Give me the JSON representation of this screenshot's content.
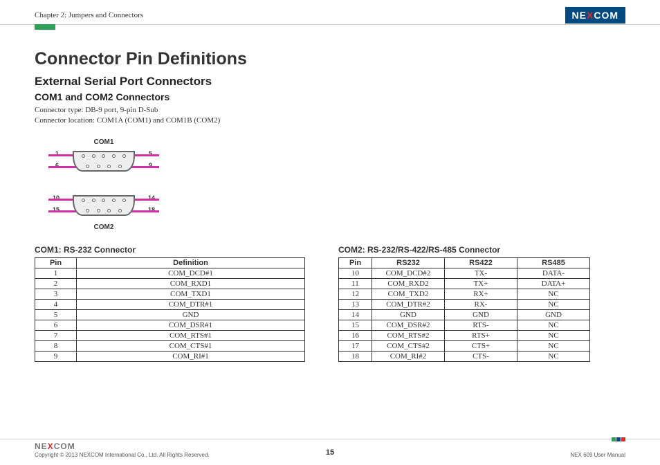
{
  "header": {
    "chapter": "Chapter 2: Jumpers and Connectors",
    "brand": "NE",
    "brand_x": "X",
    "brand2": "COM"
  },
  "titles": {
    "h1": "Connector Pin Definitions",
    "h2": "External Serial Port Connectors",
    "h3": "COM1 and COM2 Connectors",
    "line1": "Connector type: DB-9 port, 9-pin D-Sub",
    "line2": "Connector location: COM1A (COM1) and COM1B (COM2)"
  },
  "diagram": {
    "com1": {
      "label": "COM1",
      "p1": "1",
      "p5": "5",
      "p6": "6",
      "p9": "9"
    },
    "com2": {
      "label": "COM2",
      "p10": "10",
      "p14": "14",
      "p15": "15",
      "p18": "18"
    }
  },
  "table1": {
    "title": "COM1: RS-232 Connector",
    "head": [
      "Pin",
      "Definition"
    ],
    "rows": [
      [
        "1",
        "COM_DCD#1"
      ],
      [
        "2",
        "COM_RXD1"
      ],
      [
        "3",
        "COM_TXD1"
      ],
      [
        "4",
        "COM_DTR#1"
      ],
      [
        "5",
        "GND"
      ],
      [
        "6",
        "COM_DSR#1"
      ],
      [
        "7",
        "COM_RTS#1"
      ],
      [
        "8",
        "COM_CTS#1"
      ],
      [
        "9",
        "COM_RI#1"
      ]
    ]
  },
  "table2": {
    "title": "COM2: RS-232/RS-422/RS-485 Connector",
    "head": [
      "Pin",
      "RS232",
      "RS422",
      "RS485"
    ],
    "rows": [
      [
        "10",
        "COM_DCD#2",
        "TX-",
        "DATA-"
      ],
      [
        "11",
        "COM_RXD2",
        "TX+",
        "DATA+"
      ],
      [
        "12",
        "COM_TXD2",
        "RX+",
        "NC"
      ],
      [
        "13",
        "COM_DTR#2",
        "RX-",
        "NC"
      ],
      [
        "14",
        "GND",
        "GND",
        "GND"
      ],
      [
        "15",
        "COM_DSR#2",
        "RTS-",
        "NC"
      ],
      [
        "16",
        "COM_RTS#2",
        "RTS+",
        "NC"
      ],
      [
        "17",
        "COM_CTS#2",
        "CTS+",
        "NC"
      ],
      [
        "18",
        "COM_RI#2",
        "CTS-",
        "NC"
      ]
    ]
  },
  "footer": {
    "copyright": "Copyright © 2013 NEXCOM International Co., Ltd. All Rights Reserved.",
    "page": "15",
    "right": "NEX 609 User Manual"
  }
}
